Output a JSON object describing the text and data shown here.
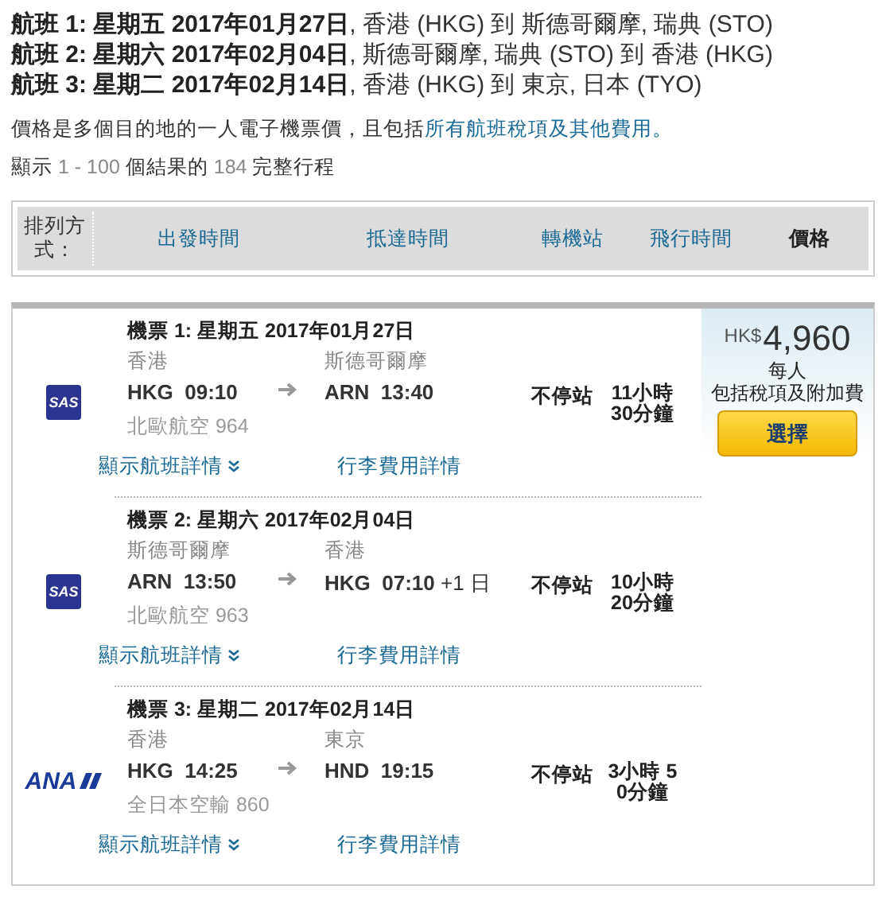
{
  "flights": [
    {
      "text": "**航班 1: 星期五 2017年01月27日**, 香港 (HKG) 到 斯德哥爾摩, 瑞典 (STO)"
    },
    {
      "text": "**航班 2: 星期六 2017年02月04日**, 斯德哥爾摩, 瑞典 (STO) 到 香港 (HKG)"
    },
    {
      "text": "**航班 3: 星期二 2017年02月14日**, 香港 (HKG) 到 東京, 日本 (TYO)"
    }
  ],
  "price_note": {
    "text": "價格是多個目的地的一人電子機票價，且包括",
    "link": "所有航班稅項及其他費用",
    "end": "。"
  },
  "results_count": {
    "prefix": "顯示",
    "range": "1 - 100",
    "middle": "個結果的",
    "total": "184",
    "suffix": "完整行程"
  },
  "sort_bar": {
    "label": "排列方式：",
    "options": [
      {
        "label": "出發時間",
        "selected": false
      },
      {
        "label": "抵達時間",
        "selected": false
      },
      {
        "label": "轉機站",
        "selected": false
      },
      {
        "label": "飛行時間",
        "selected": false
      },
      {
        "label": "價格",
        "selected": true
      }
    ]
  },
  "result": {
    "legs": [
      {
        "logo": {
          "kind": "sas",
          "text": "SAS"
        },
        "title": "機票 1: 星期五 2017年01月27日",
        "from_city": "香港",
        "from_code": "HKG",
        "from_time": "09:10",
        "to_city": "斯德哥爾摩",
        "to_code": "ARN",
        "to_time": "13:40",
        "stops": "不停站",
        "duration": "11小時 30分鐘",
        "flight": "北歐航空 964",
        "details_link": "顯示航班詳情",
        "baggage_link": "行李費用詳情"
      },
      {
        "logo": {
          "kind": "sas",
          "text": "SAS"
        },
        "title": "機票 2: 星期六 2017年02月04日",
        "from_city": "斯德哥爾摩",
        "from_code": "ARN",
        "from_time": "13:50",
        "to_city": "香港",
        "to_code": "HKG",
        "to_time": "07:10",
        "day_offset": "+1 日",
        "stops": "不停站",
        "duration": "10小時 20分鐘",
        "flight": "北歐航空 963",
        "details_link": "顯示航班詳情",
        "baggage_link": "行李費用詳情"
      },
      {
        "logo": {
          "kind": "ana",
          "text": "ANA"
        },
        "title": "機票 3: 星期二 2017年02月14日",
        "from_city": "香港",
        "from_code": "HKG",
        "from_time": "14:25",
        "to_city": "東京",
        "to_code": "HND",
        "to_time": "19:15",
        "stops": "不停站",
        "duration": "3小時 50分鐘",
        "flight": "全日本空輸 860",
        "details_link": "顯示航班詳情",
        "baggage_link": "行李費用詳情"
      }
    ],
    "price": {
      "currency": "HK$",
      "amount": "4,960",
      "per": "每人",
      "includes": "包括稅項及附加費",
      "button": "選擇"
    }
  }
}
